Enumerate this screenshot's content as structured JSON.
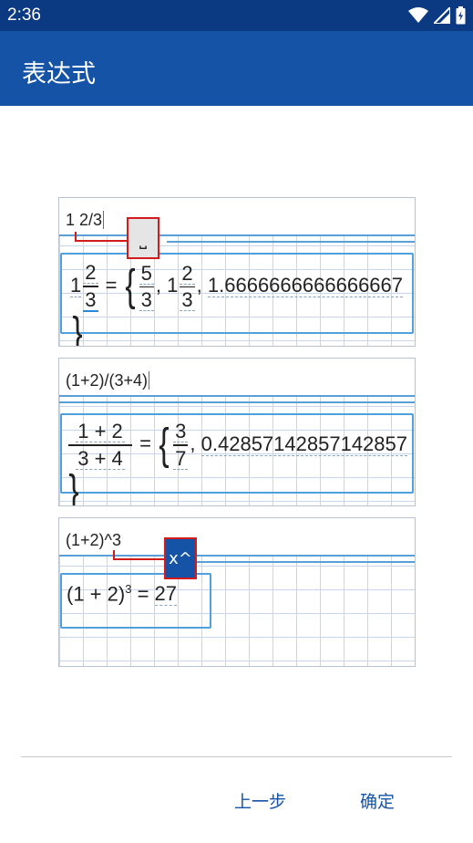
{
  "status_bar": {
    "time": "2:36",
    "icons": [
      "wifi-icon",
      "signal-icon",
      "battery-icon"
    ]
  },
  "app_bar": {
    "title": "表达式"
  },
  "examples": [
    {
      "input": "1 2/3",
      "key_hint": "⎵",
      "result": {
        "lhs_whole": "1",
        "lhs_num": "2",
        "lhs_den": "3",
        "eq": "=",
        "v1_num": "5",
        "v1_den": "3",
        "v2_whole": "1",
        "v2_num": "2",
        "v2_den": "3",
        "v3": "1.6666666666666667",
        "comma": ","
      }
    },
    {
      "input": "(1+2)/(3+4)",
      "result": {
        "num": "1 + 2",
        "den": "3 + 4",
        "eq": "=",
        "v1_num": "3",
        "v1_den": "7",
        "v2": "0.42857142857142857",
        "comma": ","
      }
    },
    {
      "input": "(1+2)^3",
      "key_hint": "x^",
      "result": {
        "base": "(1 + 2)",
        "exp": "3",
        "eq": "=",
        "value": "27"
      }
    }
  ],
  "buttons": {
    "prev": "上一步",
    "ok": "确定"
  },
  "colors": {
    "status_bar": "#0b3a82",
    "app_bar": "#1553a6",
    "accent": "#1553a6",
    "highlight_red": "#d31b1b",
    "key_dark": "#1553a6"
  }
}
